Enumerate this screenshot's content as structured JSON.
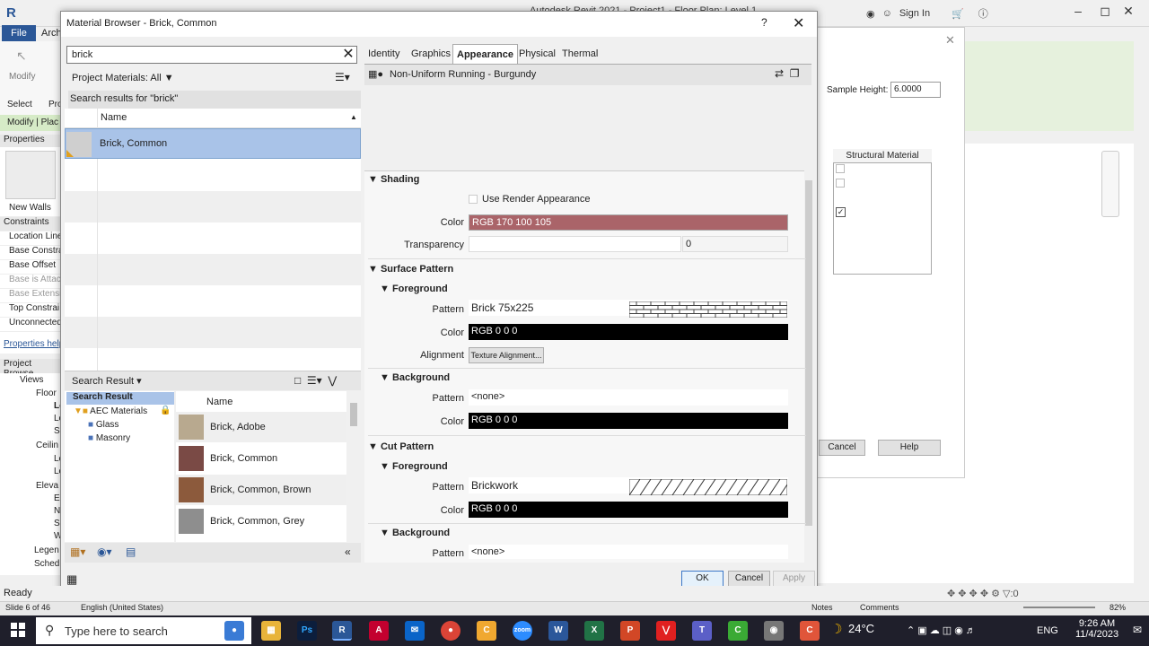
{
  "revit": {
    "title": "Autodesk Revit 2021 - Project1 - Floor Plan: Level 1",
    "sign_in": "Sign In",
    "file_tab": "File",
    "arch_tab": "Arch",
    "modify": "Modify",
    "select": "Select",
    "pro": "Pro",
    "modify_place": "Modify | Plac",
    "properties": "Properties",
    "props_rows": [
      "New Walls",
      "Constraints",
      "Location Line",
      "Base Constra",
      "Base Offset",
      "Base is Attac",
      "Base Extensio",
      "Top Constrai",
      "Unconnected"
    ],
    "properties_help": "Properties help",
    "project_browser": "Project Browse",
    "pb_rows": [
      "Views",
      "Floor",
      "Le",
      "Le",
      "Si",
      "Ceilin",
      "Le",
      "Le",
      "Eleva",
      "Ea",
      "N",
      "Sc",
      "W",
      "Legen",
      "Sched"
    ],
    "ready": "Ready",
    "sample_height_label": "Sample Height:",
    "sample_height_value": "6.0000",
    "structural_material": "Structural Material",
    "cancel": "Cancel",
    "help": "Help"
  },
  "dialog": {
    "title": "Material Browser - Brick, Common",
    "help_glyph": "?",
    "close_glyph": "✕",
    "search_value": "brick",
    "project_materials": "Project Materials: All",
    "search_results_label": "Search results for \"brick\"",
    "name_column": "Name",
    "selected_material": "Brick, Common",
    "library_title": "Search Result",
    "tree": {
      "root": "Search Result",
      "aec": "AEC Materials",
      "glass": "Glass",
      "masonry": "Masonry"
    },
    "library_name_column": "Name",
    "library_items": [
      {
        "name": "Brick, Adobe",
        "color": "#b8a98f"
      },
      {
        "name": "Brick, Common",
        "color": "#7a4a45"
      },
      {
        "name": "Brick, Common, Brown",
        "color": "#8c5a3c"
      },
      {
        "name": "Brick, Common, Grey",
        "color": "#8e8e8e"
      }
    ],
    "tabs": [
      "Identity",
      "Graphics",
      "Appearance",
      "Physical",
      "Thermal"
    ],
    "active_tab": "Appearance",
    "asset_name": "Non-Uniform Running - Burgundy",
    "shading": {
      "section": "Shading",
      "use_render_appearance": "Use Render Appearance",
      "color_label": "Color",
      "color_value": "RGB 170 100 105",
      "color_hex": "#aa6469",
      "transparency_label": "Transparency",
      "transparency_value": "0"
    },
    "surface_pattern": {
      "section": "Surface Pattern",
      "foreground": "Foreground",
      "pattern_label": "Pattern",
      "pattern_value": "Brick 75x225",
      "color_label": "Color",
      "color_value": "RGB 0 0 0",
      "alignment_label": "Alignment",
      "alignment_button": "Texture Alignment...",
      "background": "Background",
      "bg_pattern_label": "Pattern",
      "bg_pattern_value": "<none>",
      "bg_color_label": "Color",
      "bg_color_value": "RGB 0 0 0"
    },
    "cut_pattern": {
      "section": "Cut Pattern",
      "foreground": "Foreground",
      "pattern_label": "Pattern",
      "pattern_value": "Brickwork",
      "color_label": "Color",
      "color_value": "RGB 0 0 0",
      "background": "Background",
      "bg_pattern_label": "Pattern",
      "bg_pattern_value": "<none>"
    },
    "ok": "OK",
    "cancel": "Cancel",
    "apply": "Apply"
  },
  "ppt_status": {
    "slide": "Slide 6 of 46",
    "language": "English (United States)",
    "notes": "Notes",
    "comments": "Comments",
    "zoom": "82%"
  },
  "taskbar": {
    "search_placeholder": "Type here to search",
    "weather": "24°C",
    "language": "ENG",
    "time": "9:26 AM",
    "date": "11/4/2023"
  }
}
